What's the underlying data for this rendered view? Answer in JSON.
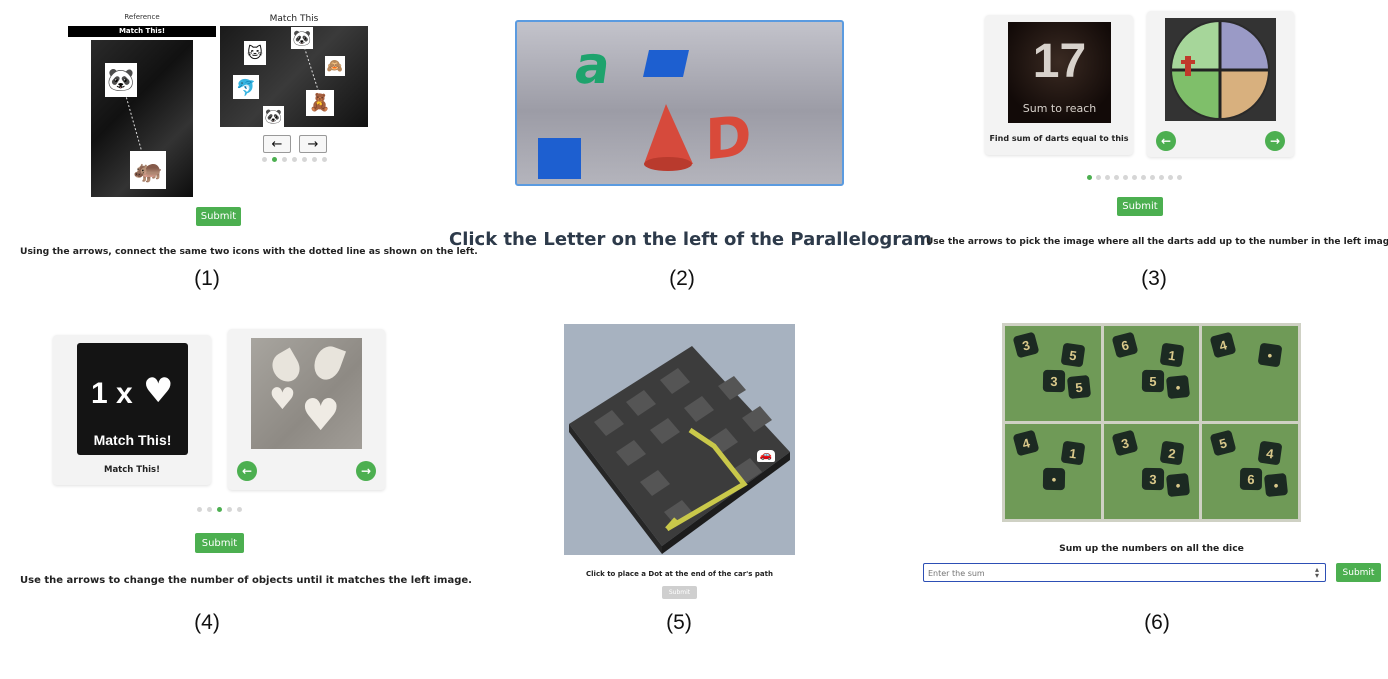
{
  "panel1": {
    "reference_label": "Reference",
    "match_bar_label": "Match This!",
    "match_title": "Match This",
    "left_arrow": "←",
    "right_arrow": "→",
    "dots_total": 7,
    "dots_active": 1,
    "submit_label": "Submit",
    "instruction": "Using the arrows, connect the same two icons with the dotted line as shown on the left.",
    "caption": "(1)"
  },
  "panel2": {
    "letter_small": "a",
    "letter_large": "D",
    "instruction": "Click the Letter on the left of the Parallelogram",
    "caption": "(2)"
  },
  "panel3": {
    "target_number": "17",
    "target_sub": "Sum to reach",
    "card_text": "Find sum of darts equal to this",
    "left_arrow": "←",
    "right_arrow": "→",
    "dots_total": 11,
    "dots_active": 0,
    "submit_label": "Submit",
    "instruction": "Use the arrows to pick the image where all the darts add up to the number in the left image.",
    "caption": "(3)"
  },
  "panel4": {
    "count_text": "1 x",
    "image_label": "Match This!",
    "card_text": "Match This!",
    "left_arrow": "←",
    "right_arrow": "→",
    "dots_total": 5,
    "dots_active": 2,
    "submit_label": "Submit",
    "instruction": "Use the arrows to change the number of objects until it matches the left image.",
    "caption": "(4)"
  },
  "panel5": {
    "instruction": "Click to place a Dot at the end of the car's path",
    "submit_label": "Submit",
    "caption": "(5)"
  },
  "panel6": {
    "dice_values": [
      [
        "3",
        "5",
        "3",
        "5"
      ],
      [
        "6",
        "1",
        "5",
        ""
      ],
      [
        "4",
        ""
      ],
      [
        "4",
        "1",
        ""
      ],
      [
        "3",
        "2",
        "3",
        ""
      ],
      [
        "5",
        "4",
        "6",
        ""
      ]
    ],
    "instruction": "Sum up the numbers on all the dice",
    "input_placeholder": "Enter the sum",
    "submit_label": "Submit",
    "caption": "(6)"
  },
  "colors": {
    "accent": "#4caf50",
    "dark": "#111111"
  }
}
